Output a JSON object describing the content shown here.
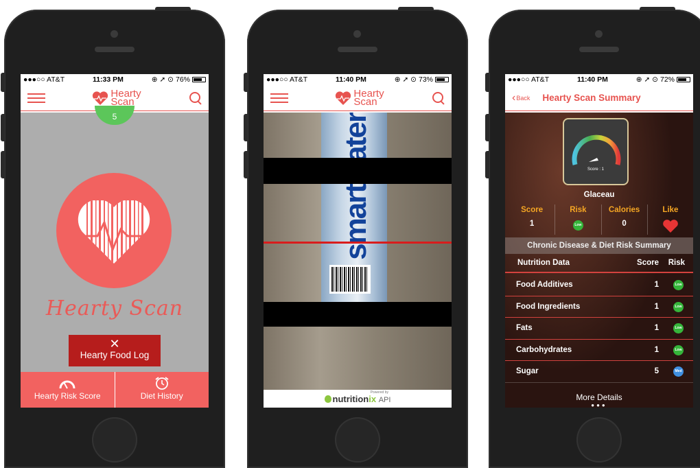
{
  "phones": [
    {
      "status": {
        "carrier": "●●●○○ AT&T",
        "time": "11:33 PM",
        "icons": "⊕ ➚ ⊙",
        "battery": "76%",
        "battery_level": 0.76
      },
      "header": {
        "logo_line1": "Hearty",
        "logo_line2": "Scan"
      },
      "score_badge": "5",
      "app_title": "Hearty Scan",
      "food_log_button": "Hearty Food Log",
      "tabs": [
        {
          "label": "Hearty Risk Score",
          "icon": "gauge-icon"
        },
        {
          "label": "Diet History",
          "icon": "alarm-clock-icon"
        }
      ]
    },
    {
      "status": {
        "carrier": "●●●○○ AT&T",
        "time": "11:40 PM",
        "icons": "⊕ ➚ ⊙",
        "battery": "73%",
        "battery_level": 0.73
      },
      "header": {
        "logo_line1": "Hearty",
        "logo_line2": "Scan"
      },
      "bottle_text": "smartwater",
      "footer": {
        "powered_by": "Powered by",
        "brand_main": "nutrition",
        "brand_x": "ix",
        "brand_api": "API"
      }
    },
    {
      "status": {
        "carrier": "●●●○○ AT&T",
        "time": "11:40 PM",
        "icons": "⊕ ➚ ⊙",
        "battery": "72%",
        "battery_level": 0.72
      },
      "back_label": "Back",
      "title": "Hearty Scan Summary",
      "gauge_label": "Score : 1",
      "product": "Glaceau",
      "stats": {
        "score_label": "Score",
        "score_value": "1",
        "risk_label": "Risk",
        "risk_value": "Low",
        "calories_label": "Calories",
        "calories_value": "0",
        "like_label": "Like"
      },
      "chronic_title": "Chronic Disease & Diet Risk Summary",
      "table_headers": {
        "name": "Nutrition Data",
        "score": "Score",
        "risk": "Risk"
      },
      "rows": [
        {
          "name": "Food Additives",
          "score": "1",
          "risk": "Low"
        },
        {
          "name": "Food Ingredients",
          "score": "1",
          "risk": "Low"
        },
        {
          "name": "Fats",
          "score": "1",
          "risk": "Low"
        },
        {
          "name": "Carbohydrates",
          "score": "1",
          "risk": "Low"
        },
        {
          "name": "Sugar",
          "score": "5",
          "risk": "Med"
        }
      ],
      "more_details": "More Details"
    }
  ],
  "colors": {
    "accent": "#e7534f",
    "dark_red": "#b61d1c",
    "green": "#5cc65a",
    "low": "#35b53a",
    "med": "#3f8fe0",
    "orange": "#f5a623"
  }
}
